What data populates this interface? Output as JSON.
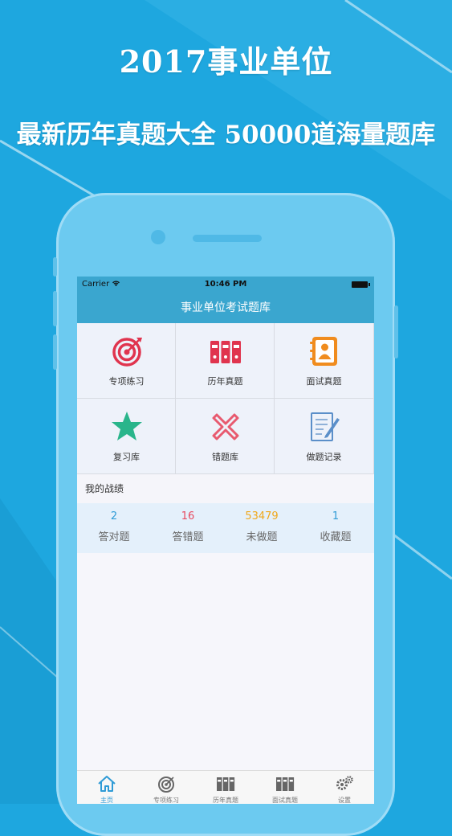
{
  "promo": {
    "headline": "2017事业单位",
    "subheadline": "最新历年真题大全 50000道海量题库"
  },
  "status_bar": {
    "carrier": "Carrier",
    "time": "10:46 PM"
  },
  "nav": {
    "title": "事业单位考试题库"
  },
  "menu": [
    {
      "label": "专项练习",
      "icon": "target-icon"
    },
    {
      "label": "历年真题",
      "icon": "binders-icon"
    },
    {
      "label": "面试真题",
      "icon": "contact-book-icon"
    },
    {
      "label": "复习库",
      "icon": "star-icon"
    },
    {
      "label": "错题库",
      "icon": "cross-icon"
    },
    {
      "label": "做题记录",
      "icon": "notepad-pen-icon"
    }
  ],
  "record": {
    "title": "我的战绩",
    "stats": [
      {
        "value": "2",
        "label": "答对题",
        "color": "#2f9bd6"
      },
      {
        "value": "16",
        "label": "答错题",
        "color": "#e84a5f"
      },
      {
        "value": "53479",
        "label": "未做题",
        "color": "#f0a81c"
      },
      {
        "value": "1",
        "label": "收藏题",
        "color": "#2f9bd6"
      }
    ]
  },
  "tabs": [
    {
      "label": "主页",
      "icon": "home-icon",
      "active": true
    },
    {
      "label": "专项练习",
      "icon": "target-icon"
    },
    {
      "label": "历年真题",
      "icon": "binders-icon"
    },
    {
      "label": "面试真题",
      "icon": "binders-icon"
    },
    {
      "label": "设置",
      "icon": "gear-icon"
    }
  ],
  "colors": {
    "brand": "#3aa6cf",
    "background": "#1ea7df",
    "active_tab": "#2f9bd6"
  }
}
